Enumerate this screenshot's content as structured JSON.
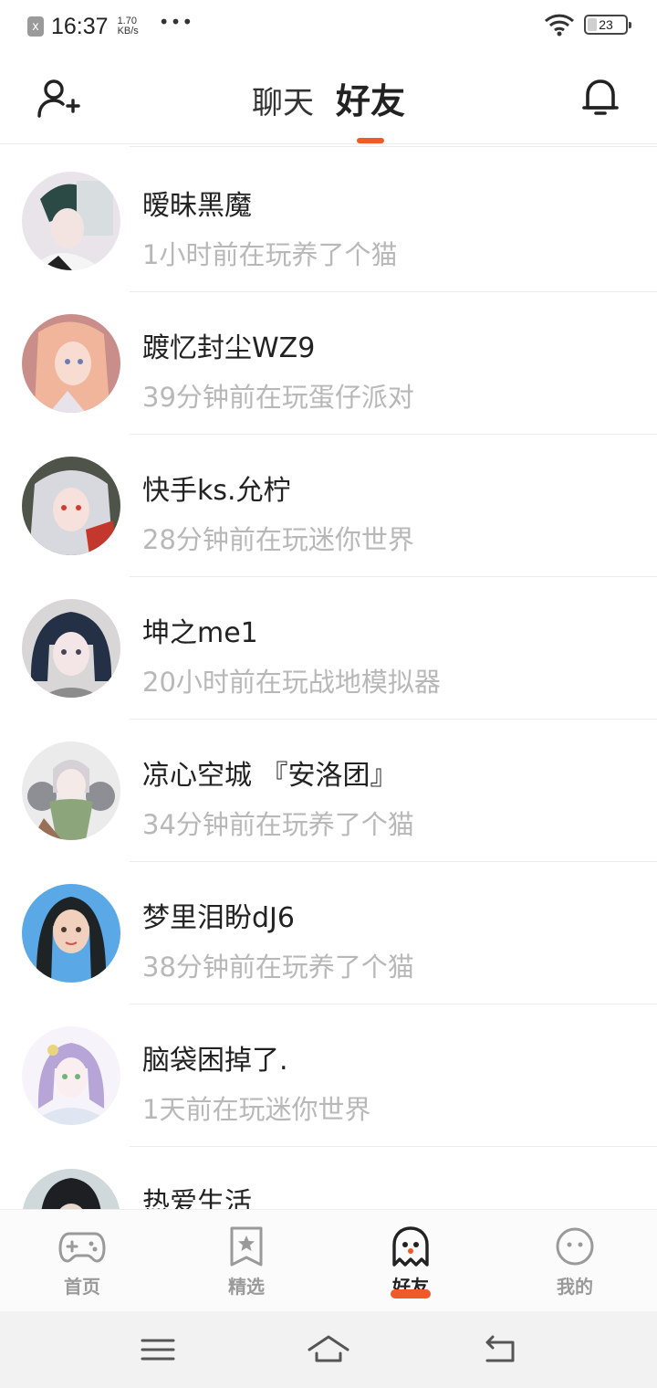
{
  "status_bar": {
    "close_badge": "x",
    "time": "16:37",
    "speed_value": "1.70",
    "speed_unit": "KB/s",
    "more": "•••",
    "battery": "23"
  },
  "header": {
    "tabs": [
      {
        "label": "聊天",
        "active": false
      },
      {
        "label": "好友",
        "active": true
      }
    ]
  },
  "friends": [
    {
      "name": "暧昧黑魔",
      "status": "1小时前在玩养了个猫"
    },
    {
      "name": "踱忆封尘WZ9",
      "status": "39分钟前在玩蛋仔派对"
    },
    {
      "name": "快手ks.允柠",
      "status": "28分钟前在玩迷你世界"
    },
    {
      "name": "坤之me1",
      "status": "20小时前在玩战地模拟器"
    },
    {
      "name": "凉心空城 『安洛团』",
      "status": "34分钟前在玩养了个猫"
    },
    {
      "name": "梦里泪盼dJ6",
      "status": "38分钟前在玩养了个猫"
    },
    {
      "name": "脑袋困掉了.",
      "status": "1天前在玩迷你世界"
    },
    {
      "name": "热爱生活",
      "status": ""
    }
  ],
  "bottom_nav": [
    {
      "label": "首页",
      "icon": "gamepad-icon",
      "active": false
    },
    {
      "label": "精选",
      "icon": "star-bookmark-icon",
      "active": false
    },
    {
      "label": "好友",
      "icon": "ghost-icon",
      "active": true
    },
    {
      "label": "我的",
      "icon": "face-icon",
      "active": false
    }
  ],
  "colors": {
    "accent": "#f05a28",
    "muted_text": "#b8b8b8",
    "text": "#222222"
  }
}
